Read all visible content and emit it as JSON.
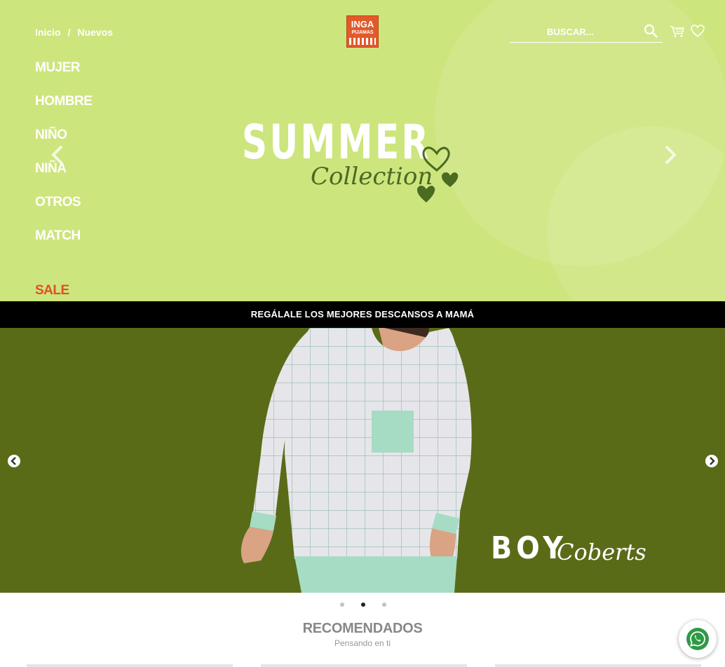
{
  "breadcrumb": {
    "items": [
      "Inicio",
      "/",
      "Nuevos"
    ]
  },
  "logo": {
    "line1": "INGA",
    "line2": "PIJAMAS"
  },
  "search": {
    "placeholder": "BUSCAR..."
  },
  "menu": {
    "items": [
      "MUJER",
      "HOMBRE",
      "NIÑO",
      "NIÑA",
      "OTROS",
      "MATCH"
    ],
    "sale": "SALE"
  },
  "hero": {
    "title": "SUMMER",
    "subtitle": "Collection"
  },
  "banner": {
    "text": "REGÁLALE LOS MEJORES DESCANSOS A MAMÁ"
  },
  "slide": {
    "title": "BOY",
    "subtitle": "Coberts"
  },
  "carousel": {
    "dots": 3,
    "active_index": 1
  },
  "recommended": {
    "title": "RECOMENDADOS",
    "subtitle": "Pensando en ti"
  },
  "colors": {
    "hero_bg": "#cde57d",
    "slide_bg": "#5a6b18",
    "sale": "#e04f2b",
    "logo": "#e25a2b",
    "whatsapp": "#2f9a45"
  },
  "icons": [
    "search-icon",
    "cart-icon",
    "heart-icon",
    "chevron-left-icon",
    "chevron-right-icon",
    "whatsapp-icon"
  ]
}
